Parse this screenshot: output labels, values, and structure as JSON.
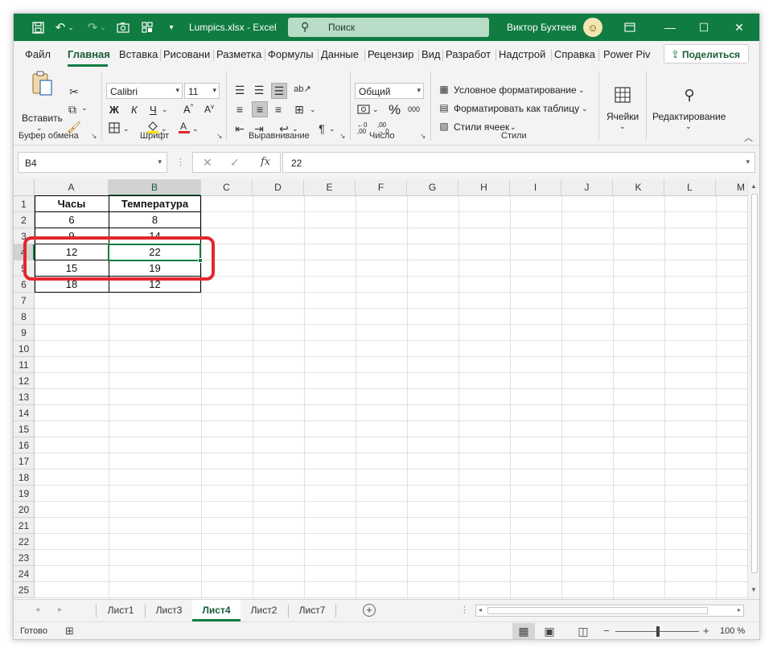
{
  "titlebar": {
    "title": "Lumpics.xlsx  -  Excel",
    "search_placeholder": "Поиск",
    "user_name": "Виктор Бухтеев",
    "accent": "#107c41"
  },
  "tabs": {
    "file": "Файл",
    "home": "Главная",
    "insert": "Вставка",
    "draw": "Рисовани",
    "layout": "Разметка",
    "formulas": "Формулы",
    "data": "Данные",
    "review": "Рецензир",
    "view": "Вид",
    "developer": "Разработ",
    "addins": "Надстрой",
    "help": "Справка",
    "powerpivot": "Power Piv",
    "share": "Поделиться"
  },
  "ribbon": {
    "paste_label": "Вставить",
    "font_name": "Calibri",
    "font_size": "11",
    "bold": "Ж",
    "italic": "К",
    "underline": "Ч",
    "number_format": "Общий",
    "conditional_formatting": "Условное форматирование",
    "format_as_table": "Форматировать как таблицу",
    "cell_styles": "Стили ячеек",
    "cells_label": "Ячейки",
    "editing_label": "Редактирование",
    "groups": {
      "clipboard": "Буфер обмена",
      "font": "Шрифт",
      "alignment": "Выравнивание",
      "number": "Число",
      "styles": "Стили"
    }
  },
  "formula_bar": {
    "name_box": "B4",
    "formula": "22",
    "fx": "fx"
  },
  "sheet": {
    "columns": [
      "A",
      "B",
      "C",
      "D",
      "E",
      "F",
      "G",
      "H",
      "I",
      "J",
      "K",
      "L",
      "M"
    ],
    "rows": [
      "1",
      "2",
      "3",
      "4",
      "5",
      "6",
      "7",
      "8",
      "9",
      "10",
      "11",
      "12",
      "13",
      "14",
      "15",
      "16",
      "17",
      "18",
      "19",
      "20",
      "21",
      "22",
      "23",
      "24",
      "25"
    ],
    "cells": {
      "a1": "Часы",
      "b1": "Температура",
      "a2": "6",
      "b2": "8",
      "a3": "9",
      "b3": "14",
      "a4": "12",
      "b4": "22",
      "a5": "15",
      "b5": "19",
      "a6": "18",
      "b6": "12"
    },
    "active_cell": "B4",
    "highlight_color": "#e3262d"
  },
  "sheet_tabs": [
    "Лист1",
    "Лист3",
    "Лист4",
    "Лист2",
    "Лист7"
  ],
  "active_sheet": "Лист4",
  "statusbar": {
    "status": "Готово",
    "zoom": "100 %"
  }
}
